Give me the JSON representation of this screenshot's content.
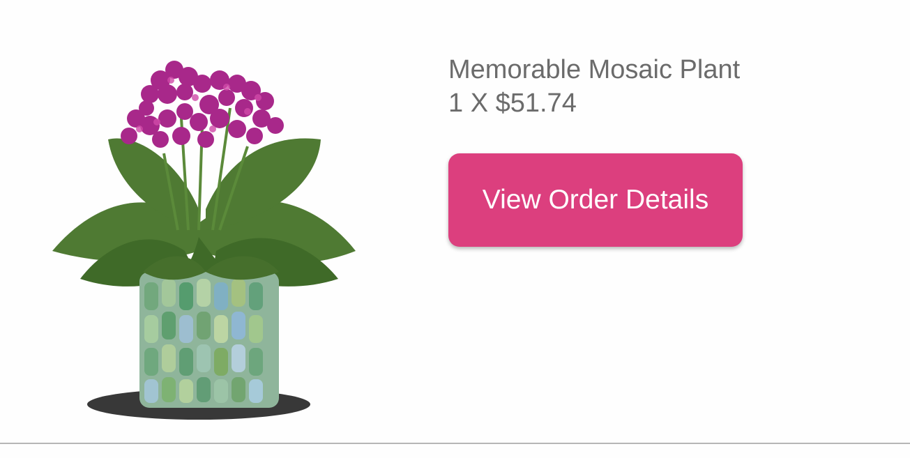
{
  "product": {
    "name": "Memorable Mosaic Plant",
    "price_line": "1 X $51.74",
    "image_icon": "kalanchoe-plant-in-mosaic-pot-image"
  },
  "actions": {
    "view_order_label": "View Order Details"
  },
  "colors": {
    "button_bg": "#dc3f7e",
    "button_text": "#ffffff",
    "text": "#6b6b6b",
    "divider": "#b6b6b6"
  }
}
